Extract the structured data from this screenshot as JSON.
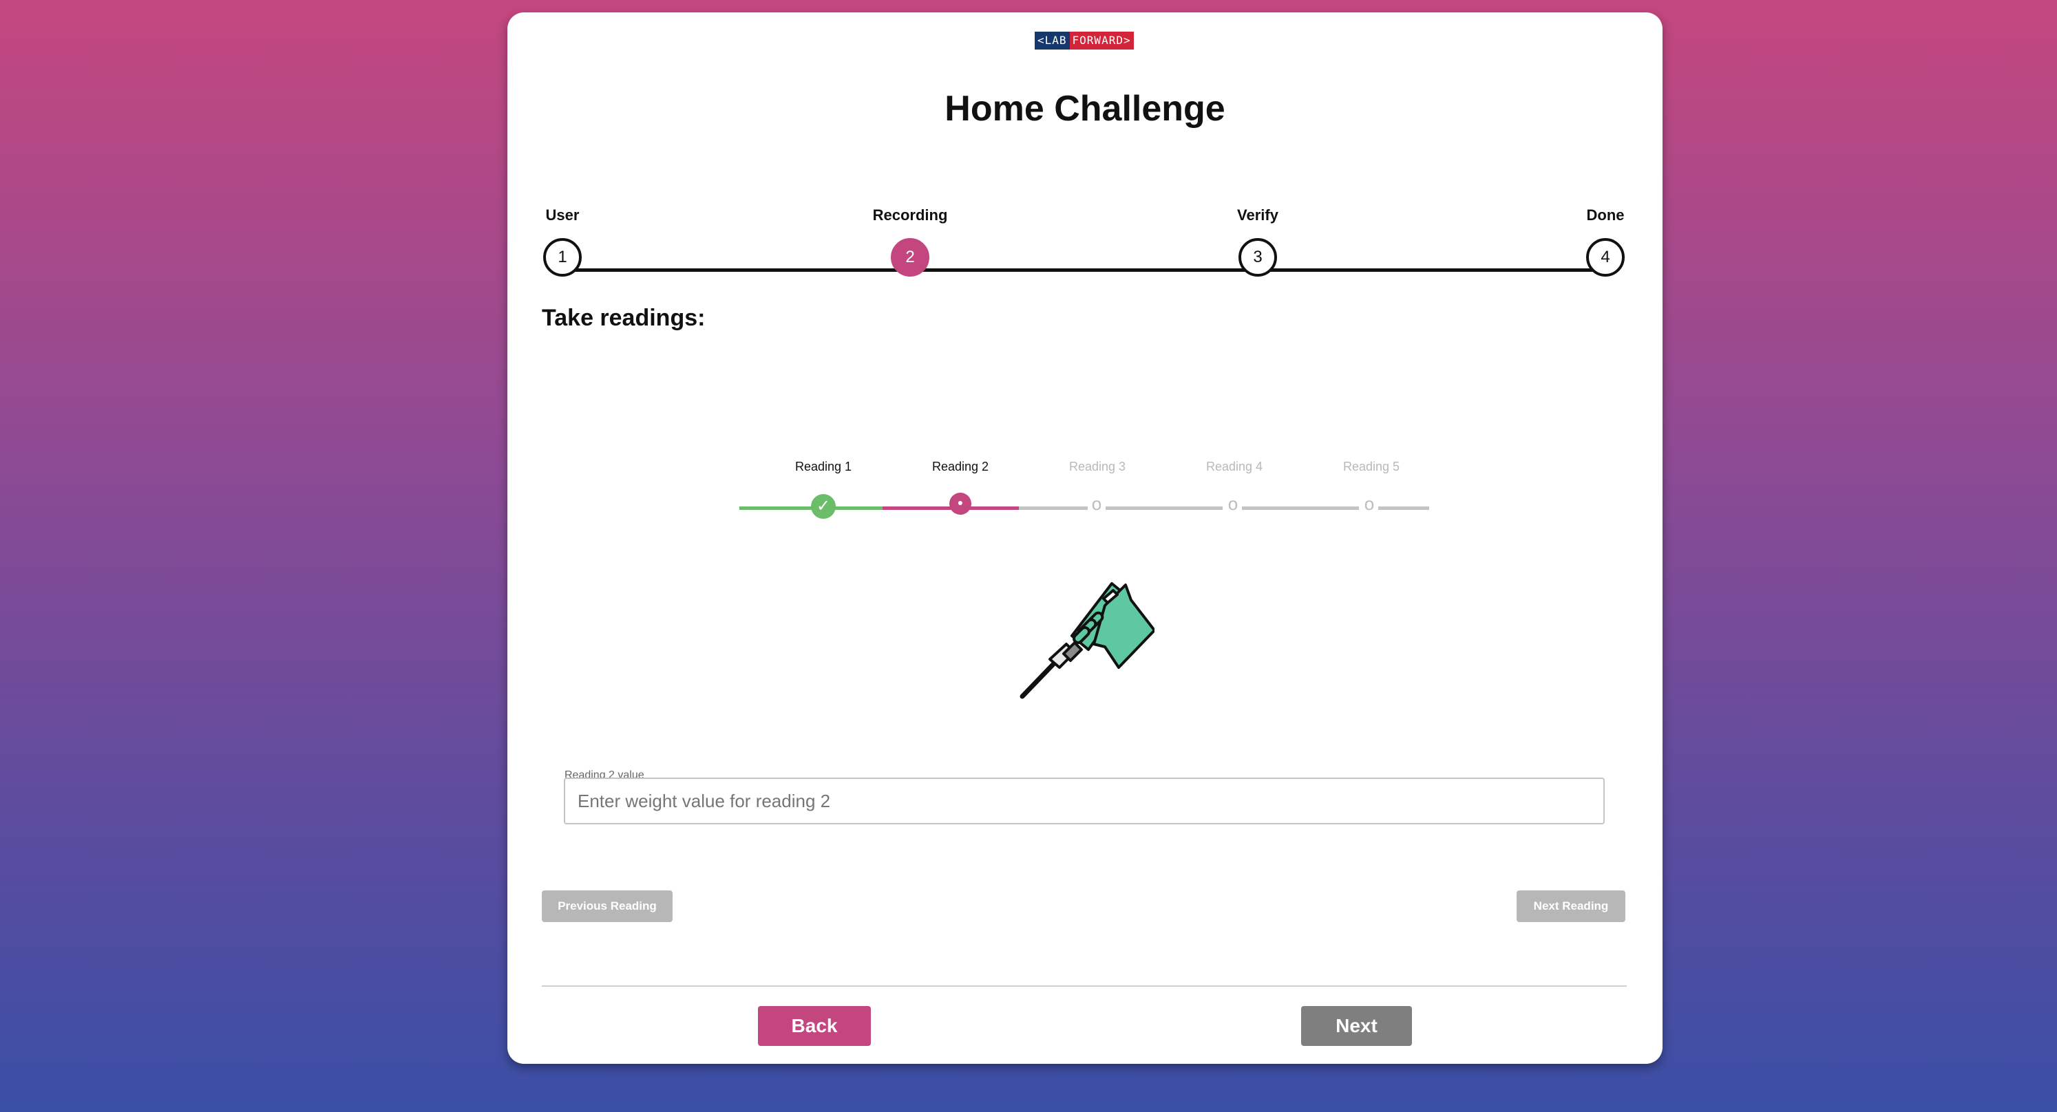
{
  "logo": {
    "part1": "<LAB",
    "part2": "FORWARD>"
  },
  "page": {
    "title": "Home Challenge"
  },
  "stepper": {
    "steps": [
      {
        "label": "User",
        "number": "1",
        "state": "pending"
      },
      {
        "label": "Recording",
        "number": "2",
        "state": "active"
      },
      {
        "label": "Verify",
        "number": "3",
        "state": "pending"
      },
      {
        "label": "Done",
        "number": "4",
        "state": "pending"
      }
    ]
  },
  "section": {
    "title": "Take readings:"
  },
  "readings": {
    "items": [
      {
        "label": "Reading 1",
        "state": "done",
        "icon": "check-icon",
        "glyph": "✓"
      },
      {
        "label": "Reading 2",
        "state": "current",
        "icon": "dot-icon",
        "glyph": "●"
      },
      {
        "label": "Reading 3",
        "state": "pending",
        "icon": "circle-icon",
        "glyph": "o"
      },
      {
        "label": "Reading 4",
        "state": "pending",
        "icon": "circle-icon",
        "glyph": "o"
      },
      {
        "label": "Reading 5",
        "state": "pending",
        "icon": "circle-icon",
        "glyph": "o"
      }
    ]
  },
  "illustration": {
    "name": "pipette-in-gloved-hand"
  },
  "form": {
    "label": "Reading 2 value",
    "placeholder": "Enter weight value for reading 2",
    "value": ""
  },
  "reading_nav": {
    "previous_label": "Previous Reading",
    "next_label": "Next Reading"
  },
  "footer": {
    "back_label": "Back",
    "next_label": "Next"
  },
  "colors": {
    "primary": "#c3467f",
    "done": "#6cbd6a",
    "disabled": "#b7b7b7",
    "next_button": "#7f7f7f",
    "logo_blue": "#16376b",
    "logo_red": "#d3253a"
  }
}
